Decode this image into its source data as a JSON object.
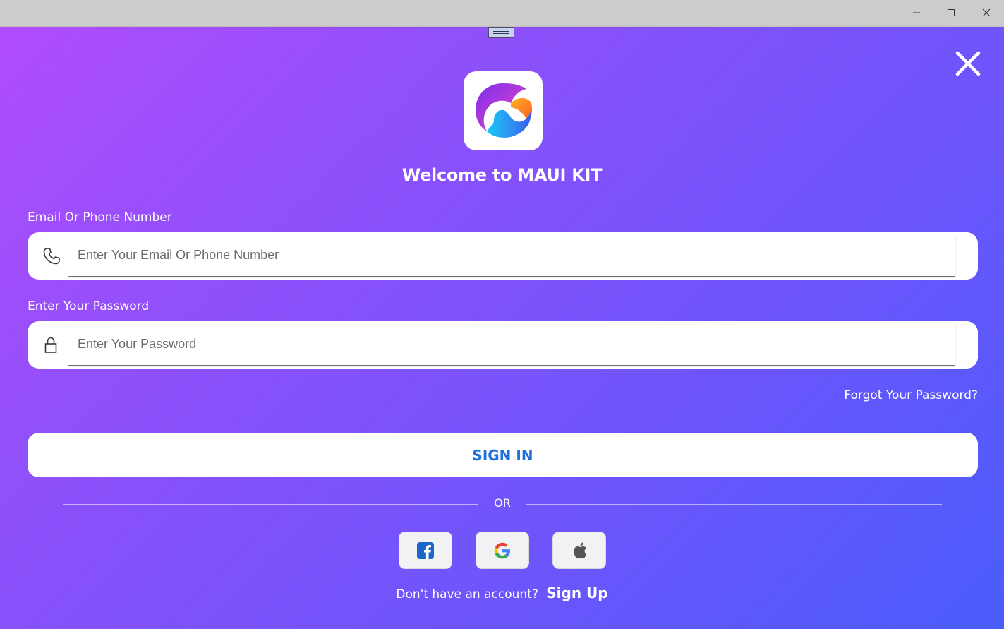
{
  "window": {
    "controls": [
      "minimize",
      "maximize",
      "close"
    ]
  },
  "header": {
    "welcome_text": "Welcome to MAUI KIT"
  },
  "email": {
    "label": "Email Or Phone Number",
    "placeholder": "Enter Your Email Or Phone Number",
    "value": "",
    "icon": "phone-icon"
  },
  "password": {
    "label": "Enter Your Password",
    "placeholder": "Enter Your Password",
    "value": "",
    "icon": "lock-icon"
  },
  "forgot_password": "Forgot Your Password?",
  "sign_in_label": "SIGN IN",
  "divider_text": "OR",
  "social": {
    "buttons": [
      "facebook-icon",
      "google-icon",
      "apple-icon"
    ]
  },
  "signup": {
    "prompt": "Don't have an account?",
    "link": "Sign Up"
  },
  "colors": {
    "gradient_start": "#b04cfb",
    "gradient_end": "#4a5cfb",
    "sign_in_text": "#1e6fdc",
    "facebook_blue": "#1877f2"
  }
}
